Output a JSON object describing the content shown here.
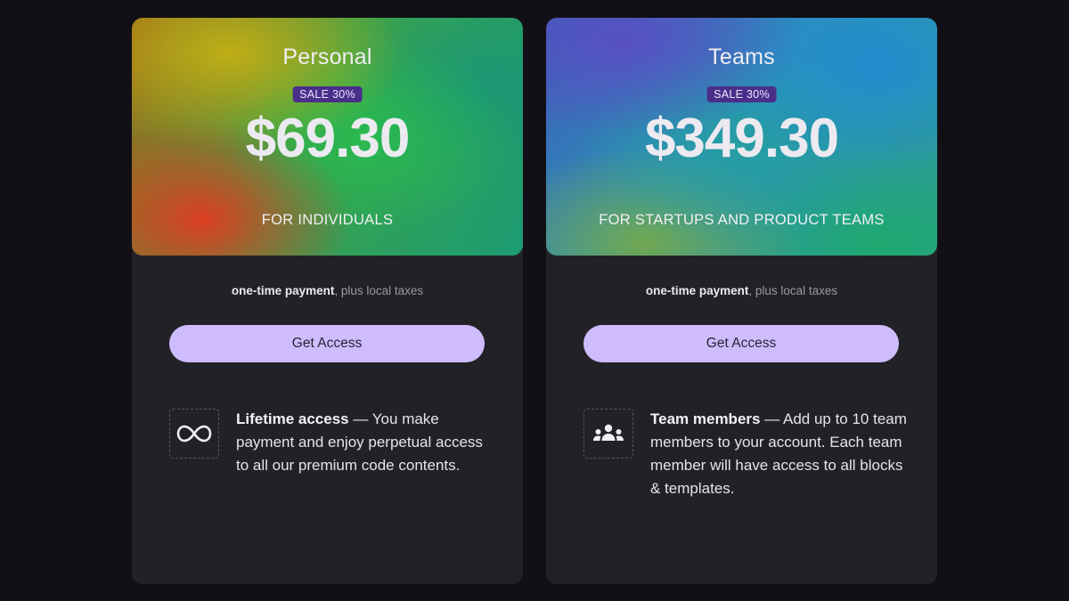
{
  "plans": [
    {
      "title": "Personal",
      "sale_badge": "SALE 30%",
      "price": "$69.30",
      "audience": "FOR INDIVIDUALS",
      "payment_strong": "one-time payment",
      "payment_rest": ", plus local taxes",
      "cta_label": "Get Access",
      "feature": {
        "icon": "infinity-icon",
        "title": "Lifetime access",
        "description": " — You make payment and enjoy perpetual access to all our premium code contents."
      }
    },
    {
      "title": "Teams",
      "sale_badge": "SALE 30%",
      "price": "$349.30",
      "audience": "FOR STARTUPS AND PRODUCT TEAMS",
      "payment_strong": "one-time payment",
      "payment_rest": ", plus local taxes",
      "cta_label": "Get Access",
      "feature": {
        "icon": "team-members-icon",
        "title": "Team members",
        "description": " — Add up to 10 team members to your account. Each team member will have access to all blocks & templates."
      }
    }
  ],
  "colors": {
    "background": "#121016",
    "card": "#222126",
    "cta": "#cebcfc",
    "badge": "#4a2f8a"
  }
}
